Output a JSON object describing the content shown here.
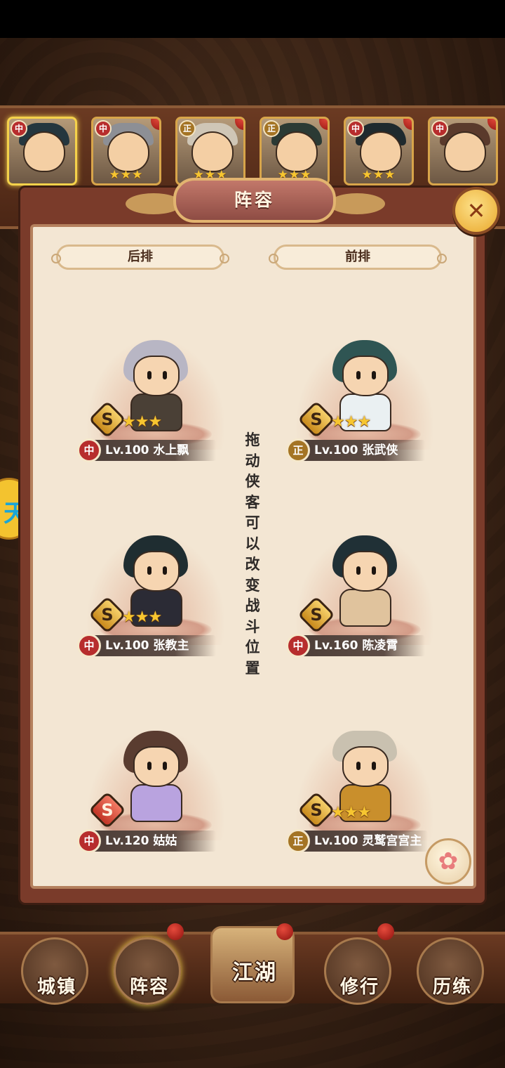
{
  "hero_strip": {
    "slots": [
      {
        "badge": "中",
        "badge_color": "#b72d2d",
        "stars": "",
        "hair": "#23343c",
        "active": true
      },
      {
        "badge": "中",
        "badge_color": "#b72d2d",
        "stars": "★★★",
        "hair": "#8d8f95",
        "active": false
      },
      {
        "badge": "正",
        "badge_color": "#a47424",
        "stars": "★★★",
        "hair": "#cfc6b6",
        "active": false
      },
      {
        "badge": "正",
        "badge_color": "#a47424",
        "stars": "★★★",
        "hair": "#2b3a34",
        "active": false
      },
      {
        "badge": "中",
        "badge_color": "#b72d2d",
        "stars": "★★★",
        "hair": "#1f2a2e",
        "active": false
      },
      {
        "badge": "中",
        "badge_color": "#b72d2d",
        "stars": "",
        "hair": "#5a3a2c",
        "active": false
      }
    ]
  },
  "dialog": {
    "title": "阵容",
    "close_icon": "✕",
    "back_row_label": "后排",
    "front_row_label": "前排",
    "hint": "拖动侠客可以改变战斗位置"
  },
  "characters": {
    "back": [
      {
        "grade": "S",
        "grade_style": "gold",
        "stars": "★★★",
        "faction": "中",
        "faction_color": "#b72d2d",
        "text": "Lv.100 水上飘",
        "hair": "#b8b6c4",
        "body": "#4a4036"
      },
      {
        "grade": "S",
        "grade_style": "gold",
        "stars": "★★★",
        "faction": "中",
        "faction_color": "#b72d2d",
        "text": "Lv.100 张教主",
        "hair": "#1f2d31",
        "body": "#2b2b35"
      },
      {
        "grade": "S",
        "grade_style": "red",
        "stars": "",
        "faction": "中",
        "faction_color": "#b72d2d",
        "text": "Lv.120 姑姑",
        "hair": "#5a3c30",
        "body": "#b9a3df"
      }
    ],
    "front": [
      {
        "grade": "S",
        "grade_style": "gold",
        "stars": "★★★",
        "faction": "正",
        "faction_color": "#a47424",
        "text": "Lv.100 张武侠",
        "hair": "#2f5553",
        "body": "#eaf0f2"
      },
      {
        "grade": "S",
        "grade_style": "gold",
        "stars": "",
        "faction": "中",
        "faction_color": "#b72d2d",
        "text": "Lv.160 陈凌霄",
        "hair": "#203036",
        "body": "#e0c39d"
      },
      {
        "grade": "S",
        "grade_style": "gold",
        "stars": "★★★",
        "faction": "正",
        "faction_color": "#a47424",
        "text": "Lv.100 灵鹫宫宫主",
        "hair": "#c9c1b0",
        "body": "#c98f2c"
      }
    ]
  },
  "side_tab_icon": "天",
  "flower_icon": "✿",
  "bottom_nav": {
    "items": [
      "城镇",
      "阵容",
      "江湖",
      "修行",
      "历练"
    ],
    "selected": "阵容"
  }
}
